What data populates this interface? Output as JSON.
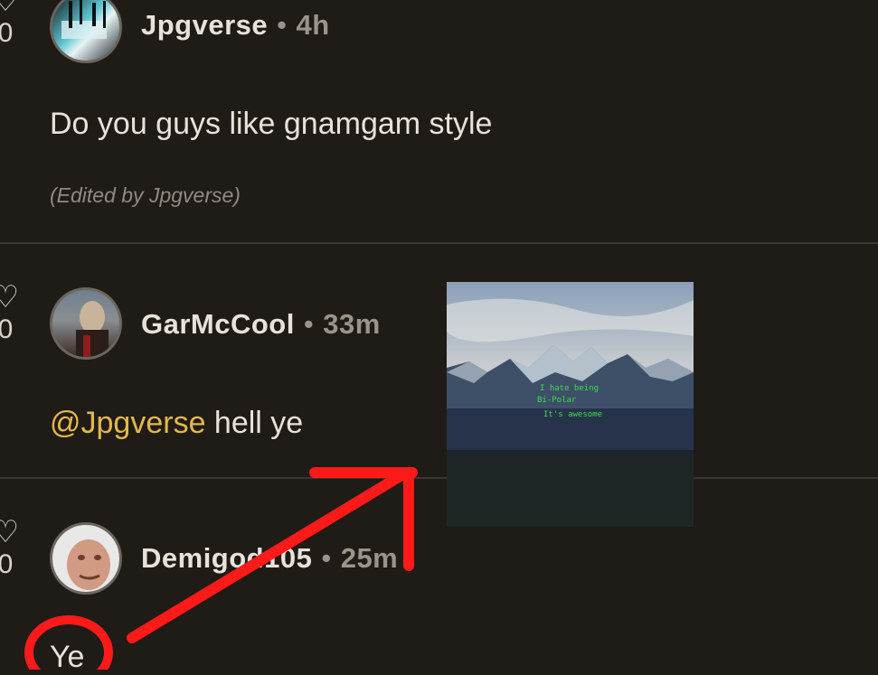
{
  "comments": [
    {
      "username": "Jpgverse",
      "time": "4h",
      "like_count": "0",
      "text": "Do you guys like gnamgam style",
      "edited": "(Edited by Jpgverse)"
    },
    {
      "username": "GarMcCool",
      "time": "33m",
      "like_count": "0",
      "mention": "@Jpgverse",
      "text": " hell ye"
    },
    {
      "username": "Demigod105",
      "time": "25m",
      "like_count": "0",
      "text": "Ye"
    }
  ],
  "separator": "•",
  "album_art": {
    "handwriting": [
      "I hate being",
      "Bi-Polar",
      "It's awesome"
    ]
  },
  "colors": {
    "background": "#1f1b17",
    "mention": "#e3b84a",
    "annotation": "#ff1a1a"
  },
  "icons": [
    "heart-icon"
  ]
}
